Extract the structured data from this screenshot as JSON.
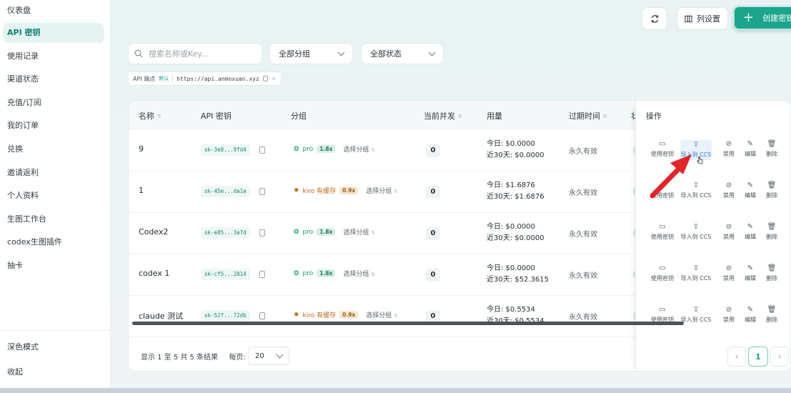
{
  "sidebar": {
    "items": [
      {
        "label": "仪表盘"
      },
      {
        "label": "API 密钥"
      },
      {
        "label": "使用记录"
      },
      {
        "label": "渠道状态"
      },
      {
        "label": "充值/订阅"
      },
      {
        "label": "我的订单"
      },
      {
        "label": "兑换"
      },
      {
        "label": "邀请返利"
      },
      {
        "label": "个人资料"
      },
      {
        "label": "生图工作台"
      },
      {
        "label": "codex生图插件"
      },
      {
        "label": "抽卡"
      }
    ],
    "active_item": "API 密钥",
    "dark_mode_label": "深色模式",
    "collapse_label": "收起"
  },
  "toolbar": {
    "columns_label": "列设置",
    "create_label": "创建密钥"
  },
  "filters": {
    "search_placeholder": "搜索名称或Key...",
    "group_select": "全部分组",
    "status_select": "全部状态"
  },
  "endpoint": {
    "label": "API 端点",
    "default_tag": "默认",
    "url": "https://api.anmoxuan.xyz"
  },
  "table": {
    "headers": {
      "name": "名称",
      "key": "API 密钥",
      "group": "分组",
      "concurrency": "当前并发",
      "usage": "用量",
      "expire": "过期时间",
      "status_partial": "状",
      "actions": "操作"
    },
    "rows": [
      {
        "name": "9",
        "key": "sk-3e8...9fd4",
        "group": "pro",
        "group_kind": "pro",
        "multiplier": "1.8x",
        "choose": "选择分组",
        "concurrency": "0",
        "today": "今日: $0.0000",
        "month": "近30天: $0.0000",
        "expire": "永久有效"
      },
      {
        "name": "1",
        "key": "sk-45e...da1a",
        "group": "kiro 有缓存",
        "group_kind": "kiro",
        "multiplier": "0.9x",
        "choose": "选择分组",
        "concurrency": "0",
        "today": "今日: $1.6876",
        "month": "近30天: $1.6876",
        "expire": "永久有效"
      },
      {
        "name": "Codex2",
        "key": "sk-e85...3a7d",
        "group": "pro",
        "group_kind": "pro",
        "multiplier": "1.8x",
        "choose": "选择分组",
        "concurrency": "0",
        "today": "今日: $0.0000",
        "month": "近30天: $0.0000",
        "expire": "永久有效"
      },
      {
        "name": "codex 1",
        "key": "sk-cf5...2814",
        "group": "pro",
        "group_kind": "pro",
        "multiplier": "1.8x",
        "choose": "选择分组",
        "concurrency": "0",
        "today": "今日: $0.0000",
        "month": "近30天: $52.3615",
        "expire": "永久有效"
      },
      {
        "name": "claude 测试",
        "key": "sk-52f...72db",
        "group": "kiro 有缓存",
        "group_kind": "kiro",
        "multiplier": "0.9x",
        "choose": "选择分组",
        "concurrency": "0",
        "today": "今日: $0.5534",
        "month": "近30天: $0.5534",
        "expire": "永久有效"
      }
    ],
    "action_labels": {
      "use": "使用密钥",
      "import": "导入到 CCS",
      "disable": "禁用",
      "edit": "编辑",
      "delete": "删除"
    }
  },
  "pagination": {
    "summary": "显示 1 至 5 共 5 条结果",
    "per_page_label": "每页:",
    "per_page_value": "20",
    "current_page": "1"
  },
  "colors": {
    "accent": "#1aa58c",
    "annotation_arrow": "#e0262a"
  }
}
